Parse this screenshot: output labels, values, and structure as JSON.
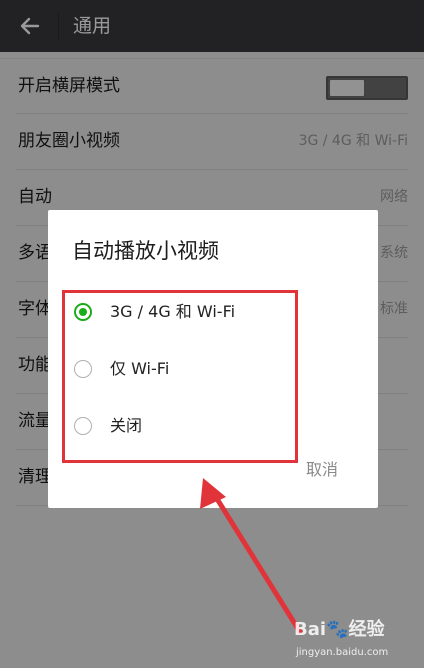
{
  "topbar": {
    "title": "通用",
    "back_icon": "arrow-left-icon"
  },
  "settings": {
    "items": [
      {
        "label": "开启横屏模式",
        "value": "",
        "toggle": "off"
      },
      {
        "label": "朋友圈小视频",
        "value": "3G / 4G 和 Wi-Fi"
      },
      {
        "label": "自动",
        "value": "网络"
      },
      {
        "label": "多语",
        "value": "系统"
      },
      {
        "label": "字体",
        "value": "标准"
      },
      {
        "label": "功能",
        "value": ""
      },
      {
        "label": "流量",
        "value": ""
      },
      {
        "label": "清理",
        "value": ""
      }
    ]
  },
  "dialog": {
    "title": "自动播放小视频",
    "options": [
      {
        "label": "3G / 4G 和 Wi-Fi",
        "selected": true
      },
      {
        "label": "仅 Wi-Fi",
        "selected": false
      },
      {
        "label": "关闭",
        "selected": false
      }
    ],
    "cancel_label": "取消"
  },
  "annotation": {
    "highlight_color": "#e0343a",
    "arrow_color": "#e0343a"
  },
  "colors": {
    "topbar": "#393a3f",
    "accent": "#1aad19"
  },
  "watermark": {
    "brand": "Bai🐾经验",
    "url": "jingyan.baidu.com"
  }
}
